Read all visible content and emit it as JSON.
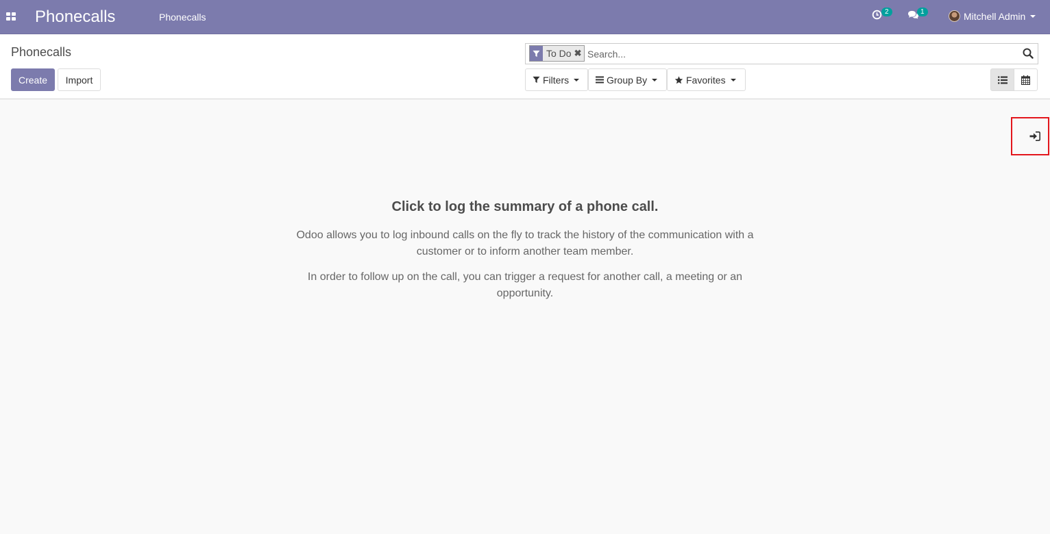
{
  "navbar": {
    "brand": "Phonecalls",
    "menu": [
      "Phonecalls"
    ],
    "activity_count": "2",
    "messages_count": "1",
    "user_name": "Mitchell Admin"
  },
  "control_panel": {
    "title": "Phonecalls",
    "create_label": "Create",
    "import_label": "Import",
    "facet_label": "To Do",
    "search_placeholder": "Search...",
    "filters_label": "Filters",
    "groupby_label": "Group By",
    "favorites_label": "Favorites"
  },
  "helper": {
    "title": "Click to log the summary of a phone call.",
    "paragraph1": "Odoo allows you to log inbound calls on the fly to track the history of the communication with a customer or to inform another team member.",
    "paragraph2": "In order to follow up on the call, you can trigger a request for another call, a meeting or an opportunity."
  },
  "icons": {
    "apps": "apps-grid-icon",
    "activity": "clock-icon",
    "messages": "comments-icon",
    "facet": "filter-icon",
    "search": "search-icon",
    "list_view": "list-icon",
    "calendar_view": "calendar-icon",
    "side_toggle": "sign-in-icon"
  },
  "colors": {
    "brand": "#7c7bad",
    "badge": "#00a09d",
    "highlight": "#e3151b"
  }
}
